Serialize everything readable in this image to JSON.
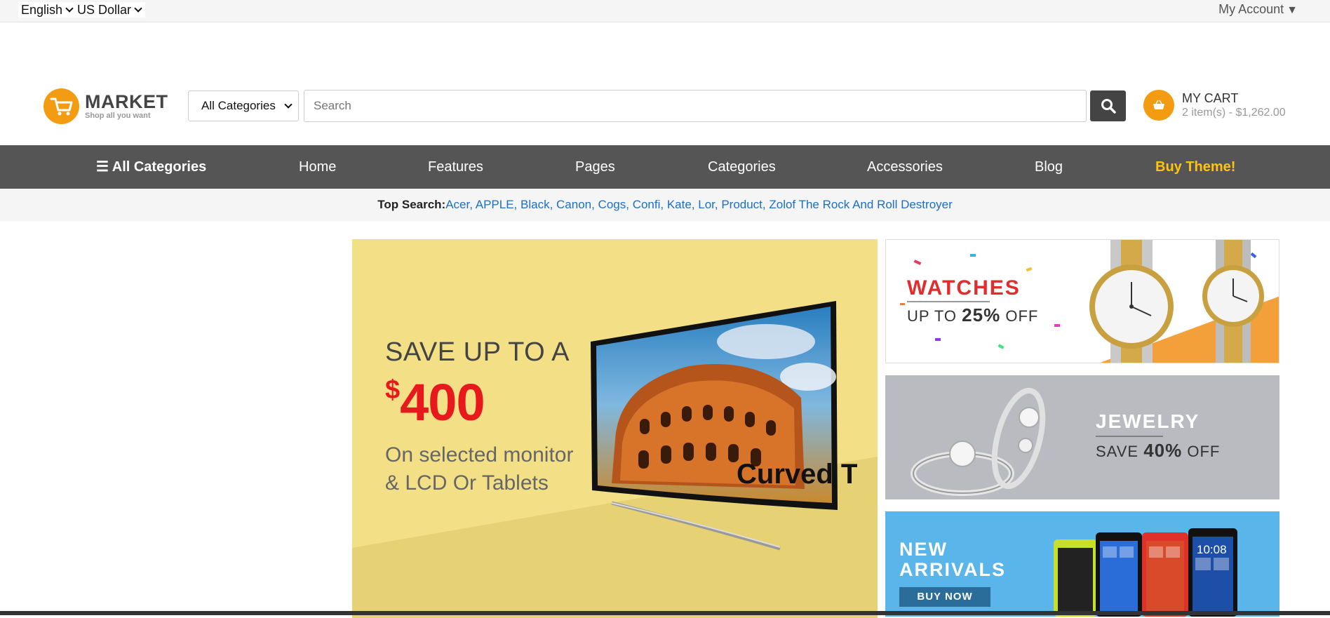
{
  "topbar": {
    "language": "English",
    "currency": "US Dollar",
    "account": "My Account",
    "account_caret": "▼"
  },
  "header": {
    "logo_title": "MARKET",
    "logo_tagline": "Shop all you want",
    "category_select": "All Categories",
    "search_placeholder": "Search",
    "cart_title": "MY CART",
    "cart_summary": "2 item(s) - $1,262.00"
  },
  "nav": {
    "all_categories": "☰ All Categories",
    "items": [
      "Home",
      "Features",
      "Pages",
      "Categories",
      "Accessories",
      "Blog"
    ],
    "buy_theme": "Buy Theme!"
  },
  "top_search": {
    "label": "Top Search:",
    "links": "Acer, APPLE, Black, Canon, Cogs, Confi, Kate, Lor, Product, Zolof The Rock And Roll Destroyer"
  },
  "main_banner": {
    "line1": "SAVE UP TO A",
    "currency_symbol": "$",
    "amount": "400",
    "line3a": "On selected monitor",
    "line3b": "& LCD Or Tablets",
    "tv_label": "Curved TV"
  },
  "side_banners": {
    "watches_title": "WATCHES",
    "watches_sub_a": "UP TO",
    "watches_sub_b": "25%",
    "watches_sub_c": "OFF",
    "jewelry_title": "JEWELRY",
    "jewelry_sub_a": "SAVE",
    "jewelry_sub_b": "40%",
    "jewelry_sub_c": "OFF",
    "arrivals_line1": "NEW",
    "arrivals_line2": "ARRIVALS",
    "arrivals_button": "BUY NOW",
    "phone_time": "10:08"
  },
  "colors": {
    "brand_orange": "#f39c12",
    "nav_bg": "#555555",
    "buy_theme": "#ffc30f",
    "link_blue": "#1a6fc9",
    "price_red": "#e8191d"
  }
}
